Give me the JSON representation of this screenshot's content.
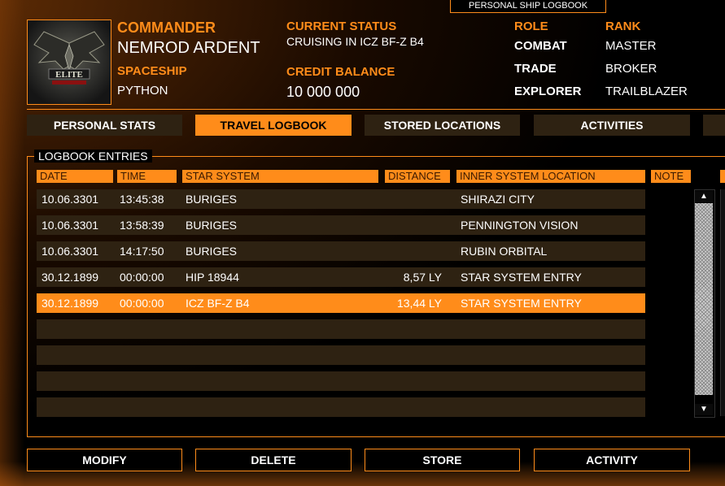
{
  "window_title": "PERSONAL SHIP LOGBOOK",
  "commander": {
    "label": "COMMANDER",
    "name": "NEMROD ARDENT"
  },
  "spaceship": {
    "label": "SPACESHIP",
    "value": "PYTHON"
  },
  "status": {
    "label": "CURRENT STATUS",
    "value": "CRUISING IN ICZ BF-Z B4"
  },
  "credit": {
    "label": "CREDIT BALANCE",
    "value": "10 000 000"
  },
  "roles": {
    "role_label": "ROLE",
    "rank_label": "RANK",
    "items": [
      {
        "role": "COMBAT",
        "rank": "MASTER"
      },
      {
        "role": "TRADE",
        "rank": "BROKER"
      },
      {
        "role": "EXPLORER",
        "rank": "TRAILBLAZER"
      }
    ]
  },
  "logo_text": "ELITE",
  "tabs": [
    {
      "label": "PERSONAL STATS",
      "active": false
    },
    {
      "label": "TRAVEL LOGBOOK",
      "active": true
    },
    {
      "label": "STORED LOCATIONS",
      "active": false
    },
    {
      "label": "ACTIVITIES",
      "active": false
    }
  ],
  "logbook": {
    "title": "LOGBOOK ENTRIES",
    "columns": [
      "DATE",
      "TIME",
      "STAR SYSTEM",
      "DISTANCE",
      "INNER SYSTEM LOCATION",
      "NOTE"
    ],
    "rows": [
      {
        "date": "10.06.3301",
        "time": "13:45:38",
        "system": "BURIGES",
        "distance": "",
        "location": "SHIRAZI CITY",
        "note": ""
      },
      {
        "date": "10.06.3301",
        "time": "13:58:39",
        "system": "BURIGES",
        "distance": "",
        "location": "PENNINGTON VISION",
        "note": ""
      },
      {
        "date": "10.06.3301",
        "time": "14:17:50",
        "system": "BURIGES",
        "distance": "",
        "location": "RUBIN ORBITAL",
        "note": ""
      },
      {
        "date": "30.12.1899",
        "time": "00:00:00",
        "system": "HIP 18944",
        "distance": "8,57 LY",
        "location": "STAR SYSTEM ENTRY",
        "note": ""
      },
      {
        "date": "30.12.1899",
        "time": "00:00:00",
        "system": "ICZ BF-Z B4",
        "distance": "13,44 LY",
        "location": "STAR SYSTEM ENTRY",
        "note": "",
        "selected": true
      }
    ],
    "empty_rows": 4
  },
  "buttons": {
    "modify": "MODIFY",
    "delete": "DELETE",
    "store": "STORE",
    "activity": "ACTIVITY"
  },
  "colors": {
    "accent": "#ff8c1a",
    "row_bg": "#2e2212",
    "background": "#000000"
  }
}
